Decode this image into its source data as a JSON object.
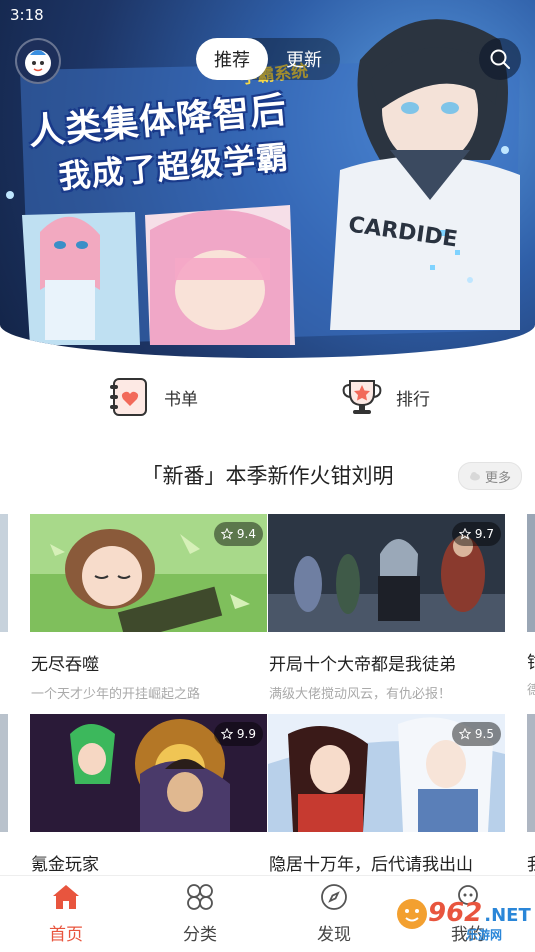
{
  "status_bar": {
    "time": "3:18"
  },
  "header": {
    "tabs": [
      {
        "label": "推荐",
        "active": true
      },
      {
        "label": "更新",
        "active": false
      }
    ],
    "avatar_icon": "cartoon-avatar-icon",
    "search_icon": "search-icon"
  },
  "banner": {
    "title_line1": "人类集体降智后",
    "title_line2": "我成了超级学霸",
    "logo_text": "学霸系统",
    "shirt_text": "CARDIDE"
  },
  "shortcuts": [
    {
      "label": "书单",
      "icon": "booklist-heart-icon"
    },
    {
      "label": "排行",
      "icon": "trophy-star-icon"
    }
  ],
  "section": {
    "title": "「新番」本季新作火钳刘明",
    "more_label": "更多"
  },
  "cards": [
    {
      "title": "无尽吞噬",
      "desc": "一个天才少年的开挂崛起之路",
      "rating": "9.4"
    },
    {
      "title": "开局十个大帝都是我徒弟",
      "desc": "满级大佬搅动风云，有仇必报！",
      "rating": "9.7"
    },
    {
      "title": "氪金玩家",
      "desc": "",
      "rating": "9.9"
    },
    {
      "title": "隐居十万年，后代请我出山",
      "desc": "",
      "rating": "9.5"
    }
  ],
  "edge_peek": {
    "title_char": "钳",
    "desc_char": "德",
    "title_char2": "我"
  },
  "bottom_nav": [
    {
      "label": "首页",
      "icon": "home-icon",
      "active": true
    },
    {
      "label": "分类",
      "icon": "grid-icon",
      "active": false
    },
    {
      "label": "发现",
      "icon": "compass-icon",
      "active": false
    },
    {
      "label": "我的",
      "icon": "user-icon",
      "active": false
    }
  ],
  "watermark": {
    "number": "962",
    "suffix": ".NET",
    "subtitle": "乐游网"
  },
  "colors": {
    "accent": "#e8553e",
    "hero_bg": "#2f5fa8",
    "text_main": "#222222",
    "text_sub": "#aaaaaa"
  }
}
